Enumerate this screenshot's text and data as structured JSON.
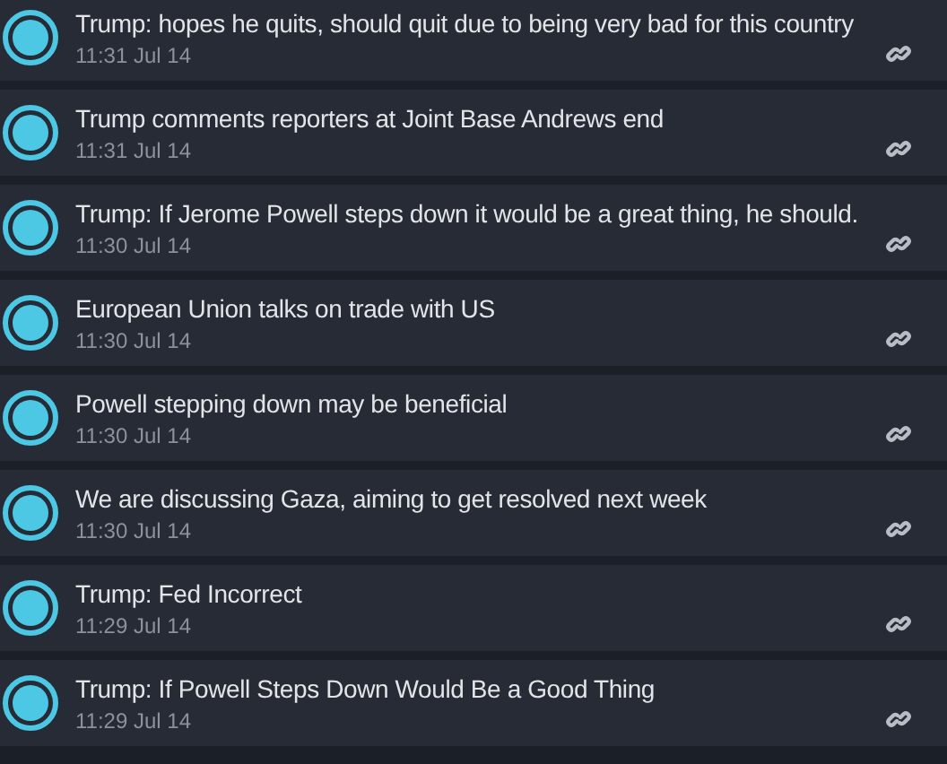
{
  "items": [
    {
      "title": "Trump: hopes he quits, should quit due to being very bad for this country",
      "time": "11:31 Jul 14"
    },
    {
      "title": "Trump comments reporters at Joint Base Andrews end",
      "time": "11:31 Jul 14"
    },
    {
      "title": "Trump: If Jerome Powell steps down it would be a great thing, he should.",
      "time": "11:30 Jul 14"
    },
    {
      "title": "European Union talks on trade with US",
      "time": "11:30 Jul 14"
    },
    {
      "title": "Powell stepping down may be beneficial",
      "time": "11:30 Jul 14"
    },
    {
      "title": "We are discussing Gaza, aiming to get resolved next week",
      "time": "11:30 Jul 14"
    },
    {
      "title": "Trump: Fed Incorrect",
      "time": "11:29 Jul 14"
    },
    {
      "title": "Trump: If Powell Steps Down Would Be a Good Thing",
      "time": "11:29 Jul 14"
    }
  ]
}
